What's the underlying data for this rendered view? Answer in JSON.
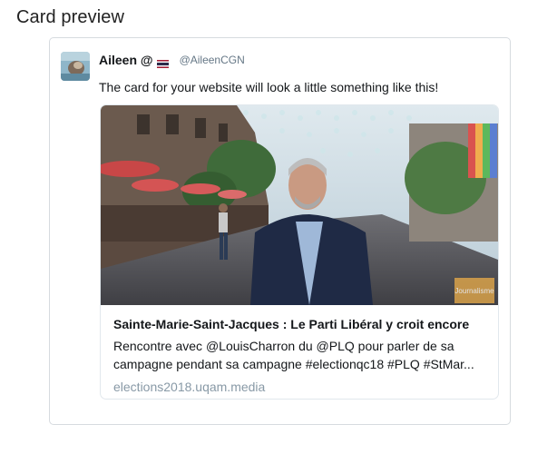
{
  "section": {
    "title": "Card preview"
  },
  "tweet": {
    "display_name": "Aileen @",
    "flag_icon": "thailand-flag-icon",
    "handle": "@AileenCGN",
    "text": "The card for your website will look a little something like this!"
  },
  "card": {
    "image_watermark": "Journalisme",
    "title": "Sainte-Marie-Saint-Jacques : Le Parti Libéral y croit encore",
    "description_line1": "Rencontre avec @LouisCharron du @PLQ pour parler de sa",
    "description_line2": "campagne pendant sa campagne #electionqc18 #PLQ #StMar...",
    "domain": "elections2018.uqam.media"
  },
  "colors": {
    "frame_border": "#d6dbdf",
    "handle_gray": "#657786",
    "domain_gray": "#8899a6",
    "text_dark": "#14171a"
  }
}
